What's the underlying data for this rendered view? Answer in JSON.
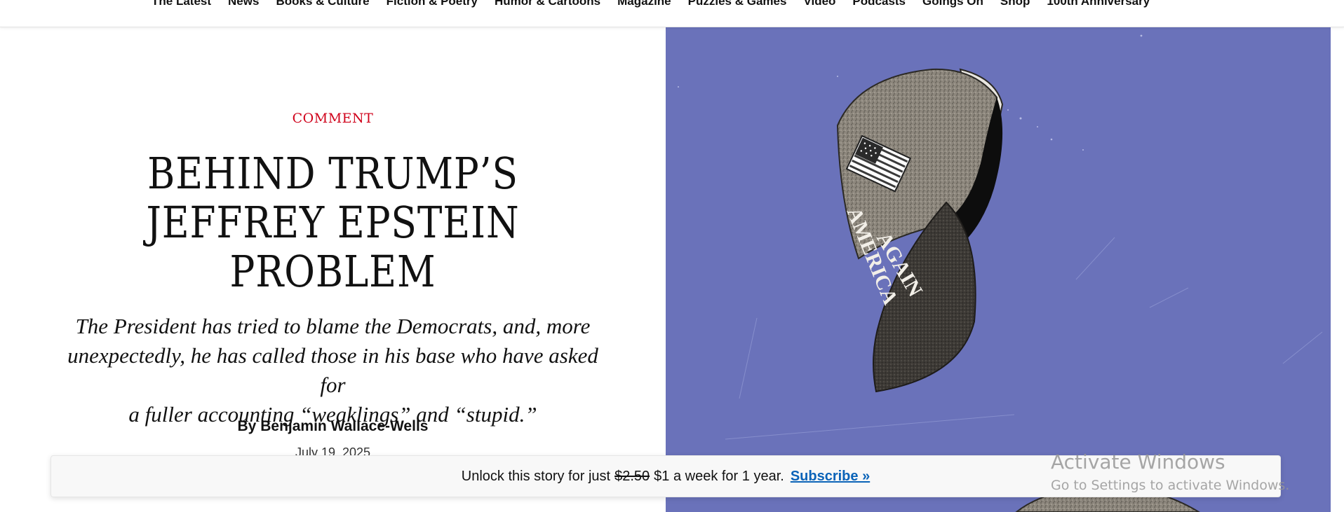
{
  "nav": {
    "items": [
      "The Latest",
      "News",
      "Books & Culture",
      "Fiction & Poetry",
      "Humor & Cartoons",
      "Magazine",
      "Puzzles & Games",
      "Video",
      "Podcasts",
      "Goings On",
      "Shop",
      "100th Anniversary"
    ]
  },
  "article": {
    "rubric": "COMMENT",
    "headline_lines": [
      "BEHIND TRUMP’S",
      "JEFFREY EPSTEIN",
      "PROBLEM"
    ],
    "dek_lines": [
      "The President has tried to blame the Democrats, and, more",
      "unexpectedly, he has called those in his base who have asked for",
      "a fuller accounting “weaklings” and “stupid.”"
    ],
    "byline_prefix": "By",
    "author": "Benjamin Wallace-Wells",
    "date": "July 19, 2025"
  },
  "hero": {
    "background_color": "#6a72ba",
    "cap_text_lines": [
      "AMERICA",
      "AGAIN"
    ],
    "icon": "baseball-cap-illustration"
  },
  "paywall": {
    "lead": "Unlock this story for just",
    "old_price": "$2.50",
    "offer": "$1 a week for 1 year.",
    "link_label": "Subscribe »",
    "link_color": "#0a63b8"
  },
  "watermark": {
    "title": "Activate Windows",
    "subtitle": "Go to Settings to activate Windows."
  }
}
